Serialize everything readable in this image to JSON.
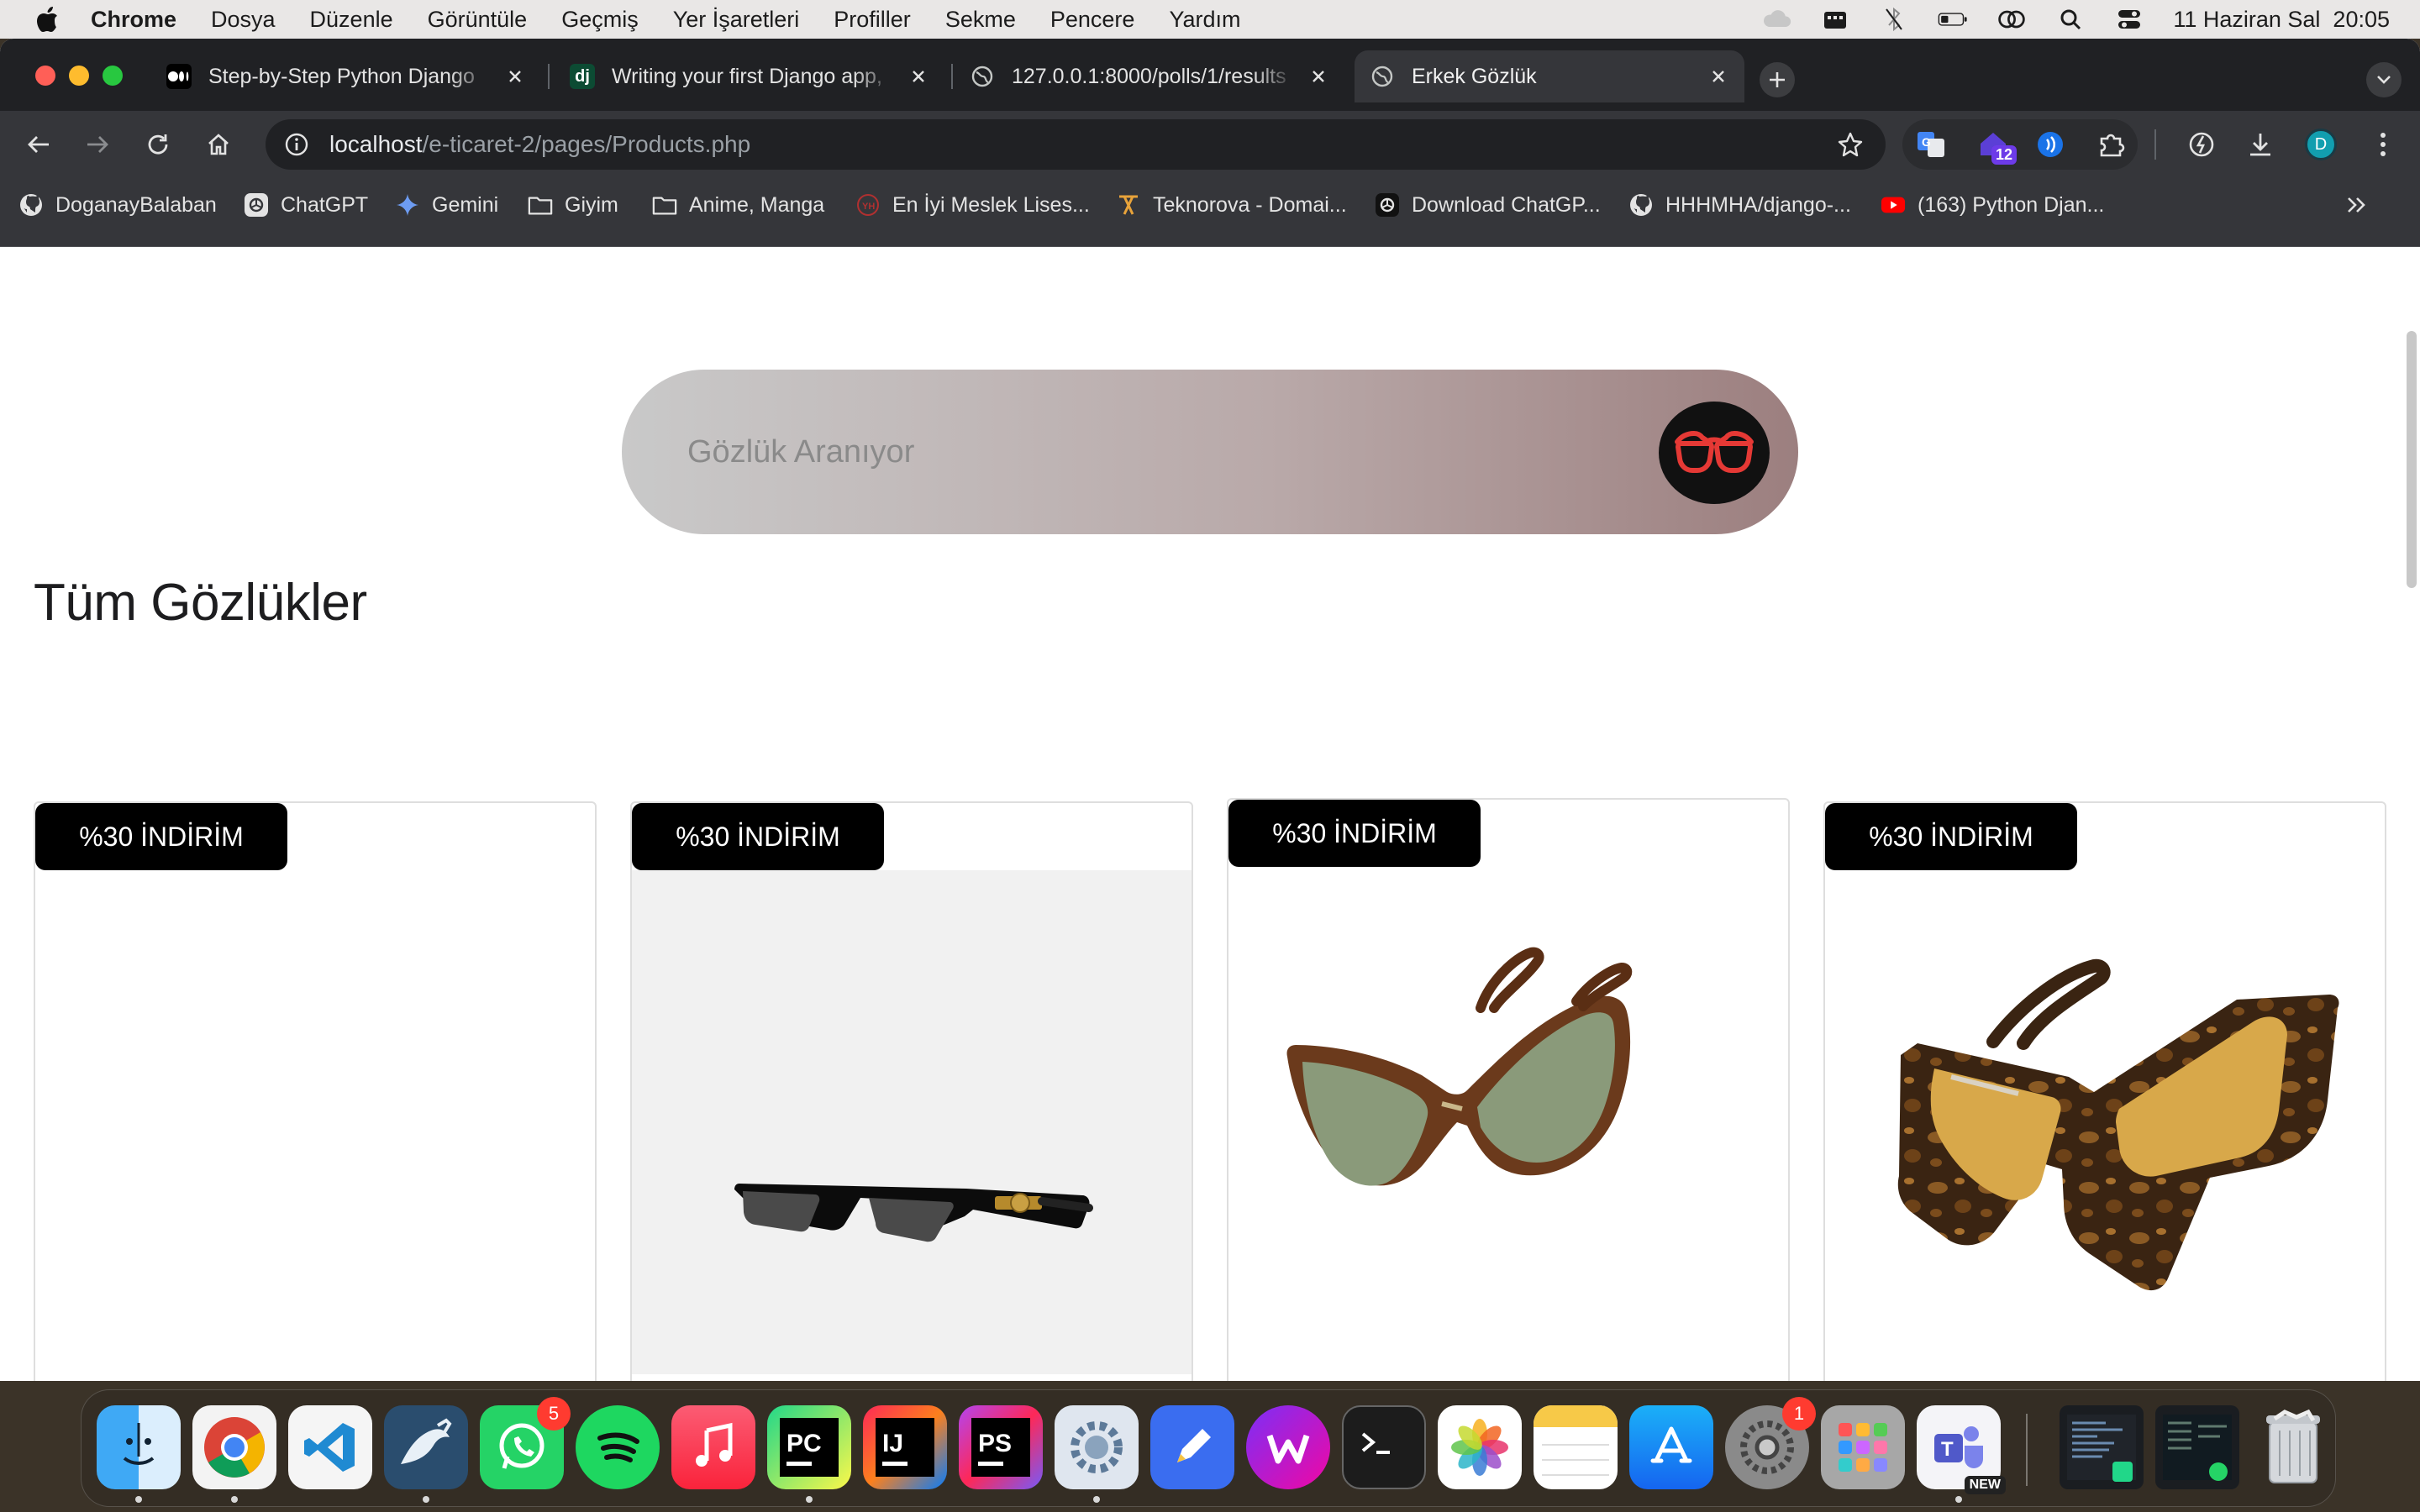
{
  "menubar": {
    "app_name": "Chrome",
    "menus": [
      "Dosya",
      "Düzenle",
      "Görüntüle",
      "Geçmiş",
      "Yer İşaretleri",
      "Profiller",
      "Sekme",
      "Pencere",
      "Yardım"
    ],
    "datetime": "11 Haziran Sal  20:05"
  },
  "tabs": [
    {
      "title": "Step-by-Step Python Django",
      "favicon": "medium-icon"
    },
    {
      "title": "Writing your first Django app,",
      "favicon": "django-icon"
    },
    {
      "title": "127.0.0.1:8000/polls/1/results",
      "favicon": "globe-icon"
    },
    {
      "title": "Erkek Gözlük",
      "favicon": "globe-icon",
      "active": true
    }
  ],
  "omnibox": {
    "host": "localhost",
    "path": "/e-ticaret-2/pages/Products.php"
  },
  "extensions": {
    "notification_count": "12",
    "profile_initial": "D"
  },
  "bookmarks": [
    {
      "label": "DoganayBalaban",
      "icon": "github-icon"
    },
    {
      "label": "ChatGPT",
      "icon": "chatgpt-icon"
    },
    {
      "label": "Gemini",
      "icon": "gemini-icon"
    },
    {
      "label": "Giyim",
      "icon": "folder-icon"
    },
    {
      "label": "Anime, Manga",
      "icon": "folder-icon"
    },
    {
      "label": "En İyi Meslek Lises...",
      "icon": "school-icon"
    },
    {
      "label": "Teknorova - Domai...",
      "icon": "teknorova-icon"
    },
    {
      "label": "Download ChatGP...",
      "icon": "chatgpt-icon"
    },
    {
      "label": "HHHMHA/django-...",
      "icon": "github-icon"
    },
    {
      "label": "(163) Python Djan...",
      "icon": "youtube-icon"
    }
  ],
  "page": {
    "search_placeholder": "Gözlük Aranıyor",
    "title": "Tüm Gözlükler",
    "products": [
      {
        "badge": "%30 İNDİRİM"
      },
      {
        "badge": "%30 İNDİRİM"
      },
      {
        "badge": "%30 İNDİRİM"
      },
      {
        "badge": "%30 İNDİRİM"
      }
    ]
  },
  "dock": {
    "whatsapp_badge": "5",
    "settings_badge": "1",
    "teams_label": "NEW"
  },
  "colors": {
    "accent_red": "#e53935",
    "tab_bg": "#202124",
    "toolbar_bg": "#35363a"
  }
}
